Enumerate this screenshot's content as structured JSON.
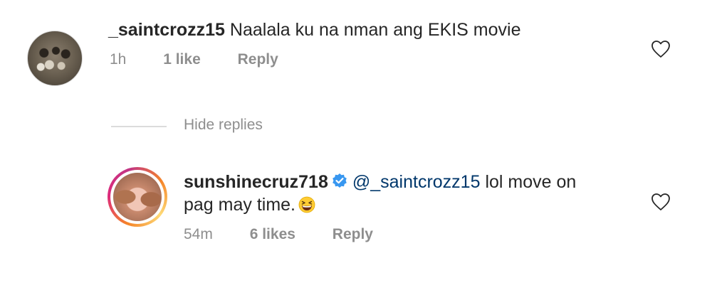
{
  "comment1": {
    "username": "_saintcrozz15",
    "text": "Naalala ku na nman ang EKIS movie",
    "time": "1h",
    "likes": "1 like",
    "reply": "Reply"
  },
  "replies": {
    "hide_label": "Hide replies"
  },
  "comment2": {
    "username": "sunshinecruz718",
    "mention": "@_saintcrozz15",
    "text_line1": "lol move on",
    "text_line2": "pag may time.",
    "time": "54m",
    "likes": "6 likes",
    "reply": "Reply"
  },
  "icons": {
    "like": "heart-outline-icon",
    "verified": "verified-badge-icon",
    "emoji": "grinning-squinting-face-emoji"
  },
  "colors": {
    "text": "#262626",
    "muted": "#8e8e8e",
    "mention": "#00376b",
    "verified": "#3897f0",
    "divider": "#dbdbdb"
  }
}
